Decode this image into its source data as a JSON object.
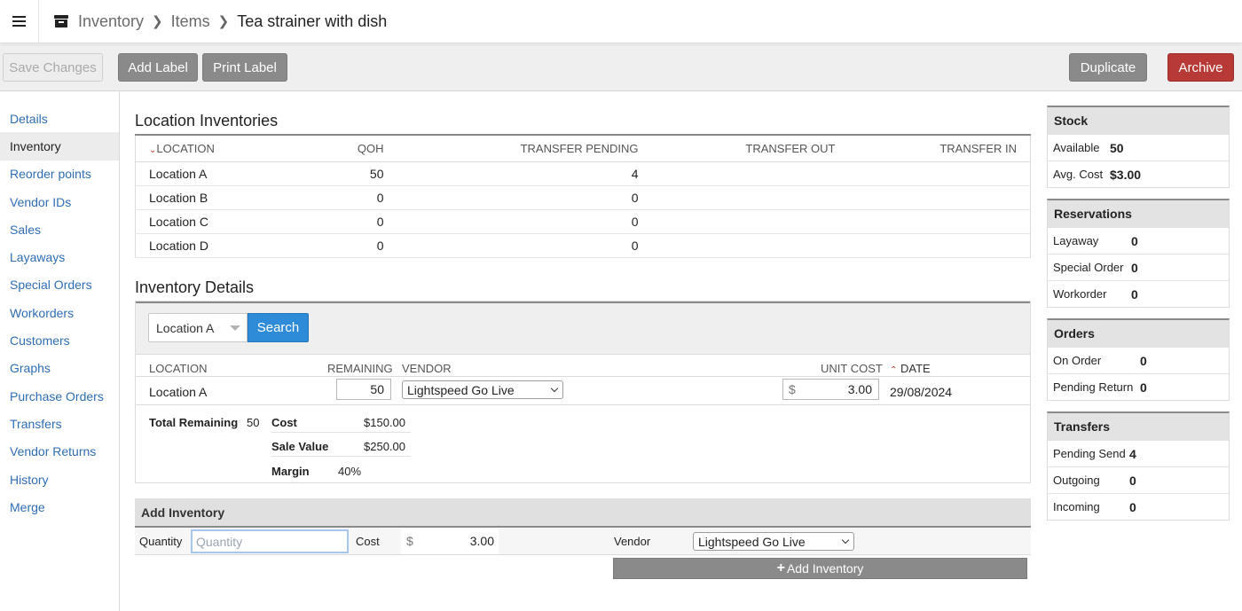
{
  "breadcrumb": {
    "root": "Inventory",
    "section": "Items",
    "current": "Tea strainer with dish"
  },
  "toolbar": {
    "save": "Save Changes",
    "add_label": "Add Label",
    "print_label": "Print Label",
    "duplicate": "Duplicate",
    "archive": "Archive"
  },
  "nav": [
    "Details",
    "Inventory",
    "Reorder points",
    "Vendor IDs",
    "Sales",
    "Layaways",
    "Special Orders",
    "Workorders",
    "Customers",
    "Graphs",
    "Purchase Orders",
    "Transfers",
    "Vendor Returns",
    "History",
    "Merge"
  ],
  "location_inventories": {
    "title": "Location Inventories",
    "headers": {
      "location": "LOCATION",
      "qoh": "QOH",
      "transfer_pending": "TRANSFER PENDING",
      "transfer_out": "TRANSFER OUT",
      "transfer_in": "TRANSFER IN"
    },
    "rows": [
      {
        "location": "Location A",
        "qoh": "50",
        "transfer_pending": "4"
      },
      {
        "location": "Location B",
        "qoh": "0",
        "transfer_pending": "0"
      },
      {
        "location": "Location C",
        "qoh": "0",
        "transfer_pending": "0"
      },
      {
        "location": "Location D",
        "qoh": "0",
        "transfer_pending": "0"
      }
    ]
  },
  "inventory_details": {
    "title": "Inventory Details",
    "filter_location": "Location A",
    "search": "Search",
    "headers": {
      "location": "LOCATION",
      "remaining": "REMAINING",
      "vendor": "VENDOR",
      "unit_cost": "UNIT COST",
      "date": "DATE"
    },
    "row": {
      "location": "Location A",
      "remaining": "50",
      "vendor": "Lightspeed Go Live",
      "currency": "$",
      "unit_cost": "3.00",
      "date": "29/08/2024"
    },
    "summary": {
      "total_remaining_label": "Total Remaining",
      "total_remaining": "50",
      "cost_label": "Cost",
      "cost": "$150.00",
      "sale_value_label": "Sale Value",
      "sale_value": "$250.00",
      "margin_label": "Margin",
      "margin": "40%"
    }
  },
  "add_inventory": {
    "title": "Add Inventory",
    "quantity_label": "Quantity",
    "quantity_placeholder": "Quantity",
    "cost_label": "Cost",
    "currency": "$",
    "cost_value": "3.00",
    "vendor_label": "Vendor",
    "vendor": "Lightspeed Go Live",
    "button": "Add Inventory"
  },
  "stock": {
    "title": "Stock",
    "available_label": "Available",
    "available": "50",
    "avg_cost_label": "Avg. Cost",
    "avg_cost": "$3.00"
  },
  "reservations": {
    "title": "Reservations",
    "layaway_label": "Layaway",
    "layaway": "0",
    "special_order_label": "Special Order",
    "special_order": "0",
    "workorder_label": "Workorder",
    "workorder": "0"
  },
  "orders": {
    "title": "Orders",
    "on_order_label": "On Order",
    "on_order": "0",
    "pending_return_label": "Pending Return",
    "pending_return": "0"
  },
  "transfers": {
    "title": "Transfers",
    "pending_send_label": "Pending Send",
    "pending_send": "4",
    "outgoing_label": "Outgoing",
    "outgoing": "0",
    "incoming_label": "Incoming",
    "incoming": "0"
  },
  "colors": {
    "link": "#2f6db3",
    "primary": "#2e8bd8",
    "danger": "#b83a36",
    "neutral_button": "#8a8a8a"
  }
}
